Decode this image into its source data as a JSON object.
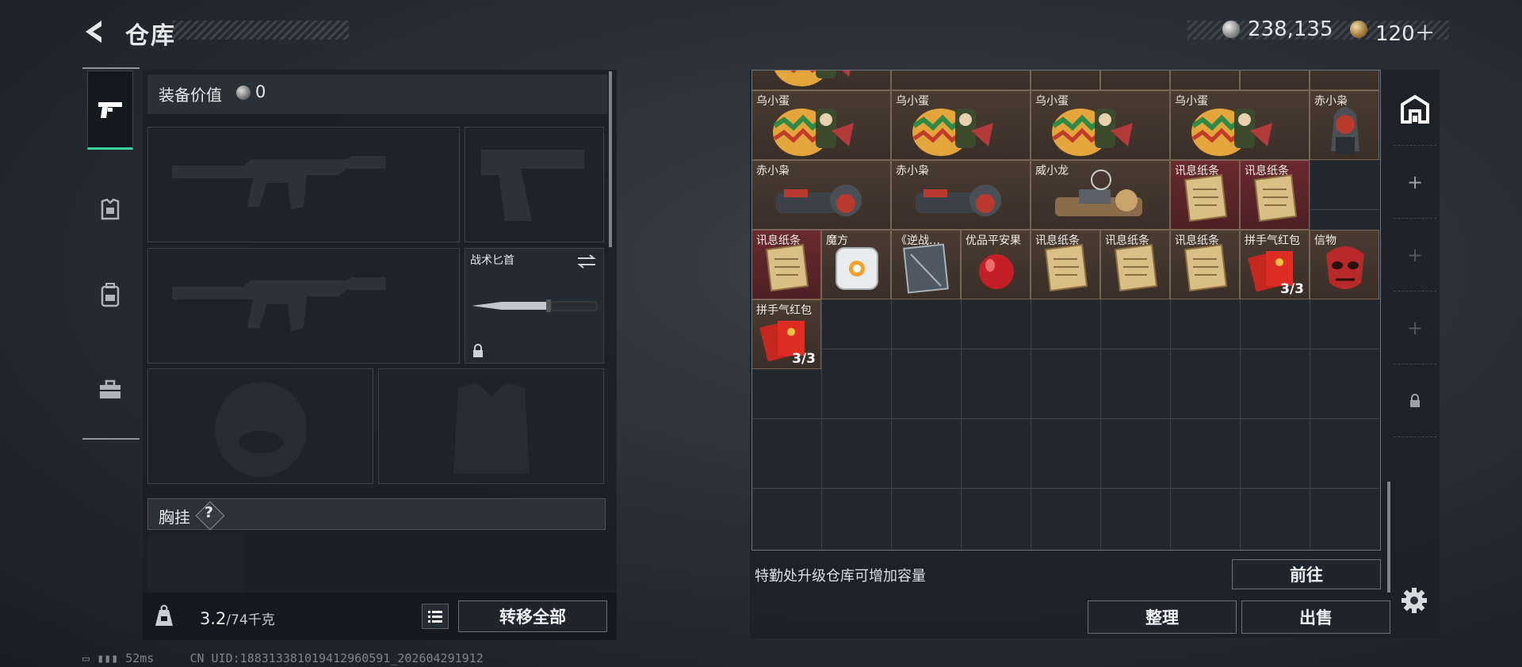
{
  "header": {
    "title": "仓库",
    "currency1": "238,135",
    "currency2": "120＋"
  },
  "left_tabs": [
    {
      "name": "weapons",
      "icon": "pistol-icon",
      "active": true
    },
    {
      "name": "armor",
      "icon": "armor-icon",
      "active": false
    },
    {
      "name": "backpack",
      "icon": "backpack-icon",
      "active": false
    },
    {
      "name": "toolbox",
      "icon": "toolbox-icon",
      "active": false
    }
  ],
  "equipment": {
    "value_label": "装备价值",
    "value": "0",
    "knife_label": "战术匕首",
    "chest_label": "胸挂",
    "chest_help": "?",
    "weight_current": "3.2",
    "weight_max": "/74千克",
    "transfer_all": "转移全部"
  },
  "inventory": {
    "items": [
      {
        "name": "乌小蛋",
        "art": "egg",
        "row": 0,
        "col": 0,
        "partial": true
      },
      {
        "name": "",
        "art": "plate",
        "row": 0,
        "col": 2,
        "partial": true
      },
      {
        "name": "",
        "art": "egg-small",
        "row": 0,
        "col": 4,
        "partial": true
      },
      {
        "name": "",
        "art": "egg-small",
        "row": 0,
        "col": 5,
        "partial": true
      },
      {
        "name": "",
        "art": "egg-small",
        "row": 0,
        "col": 6,
        "partial": true
      },
      {
        "name": "",
        "art": "egg-small",
        "row": 0,
        "col": 7,
        "partial": true
      },
      {
        "name": "",
        "art": "egg-small",
        "row": 0,
        "col": 8,
        "partial": true
      },
      {
        "name": "乌小蛋",
        "art": "egg",
        "row": 1,
        "col": 0
      },
      {
        "name": "乌小蛋",
        "art": "egg",
        "row": 1,
        "col": 2
      },
      {
        "name": "乌小蛋",
        "art": "egg",
        "row": 1,
        "col": 4
      },
      {
        "name": "乌小蛋",
        "art": "egg",
        "row": 1,
        "col": 6
      },
      {
        "name": "赤小枭",
        "art": "figure",
        "row": 1,
        "col": 8
      },
      {
        "name": "赤小枭",
        "art": "figure-lying",
        "row": 2,
        "col": 0
      },
      {
        "name": "赤小枭",
        "art": "figure-lying",
        "row": 2,
        "col": 2
      },
      {
        "name": "威小龙",
        "art": "dragon",
        "row": 2,
        "col": 4
      },
      {
        "name": "讯息纸条",
        "art": "paper",
        "row": 2,
        "col": 6,
        "red": true
      },
      {
        "name": "讯息纸条",
        "art": "paper",
        "row": 2,
        "col": 7,
        "red": true
      },
      {
        "name": "讯息纸条",
        "art": "paper",
        "row": 3,
        "col": 0,
        "red": true
      },
      {
        "name": "魔方",
        "art": "cube",
        "row": 3,
        "col": 1
      },
      {
        "name": "《逆战…",
        "art": "book",
        "row": 3,
        "col": 2
      },
      {
        "name": "优品平安果",
        "art": "apple",
        "row": 3,
        "col": 3
      },
      {
        "name": "讯息纸条",
        "art": "paper",
        "row": 3,
        "col": 4
      },
      {
        "name": "讯息纸条",
        "art": "paper",
        "row": 3,
        "col": 5
      },
      {
        "name": "讯息纸条",
        "art": "paper",
        "row": 3,
        "col": 6
      },
      {
        "name": "拼手气红包",
        "art": "envelope",
        "row": 3,
        "col": 7,
        "count": "3/3"
      },
      {
        "name": "信物",
        "art": "mask",
        "row": 3,
        "col": 8
      },
      {
        "name": "拼手气红包",
        "art": "envelope",
        "row": 4,
        "col": 0,
        "count": "3/3"
      }
    ],
    "capacity_note": "特勤处升级仓库可增加容量",
    "goto_label": "前往",
    "sort_label": "整理",
    "sell_label": "出售"
  },
  "right_tabs": [
    "warehouse-icon",
    "plus-icon",
    "plus-icon",
    "plus-icon",
    "lock-icon"
  ],
  "status_bar": {
    "ping": "52ms",
    "uid": "CN UID:1883133810194129605​91_202604291912"
  },
  "colors": {
    "accent": "#3ad3a0",
    "cell_brown": "#4a3b31",
    "cell_red": "#6a2a2e"
  }
}
